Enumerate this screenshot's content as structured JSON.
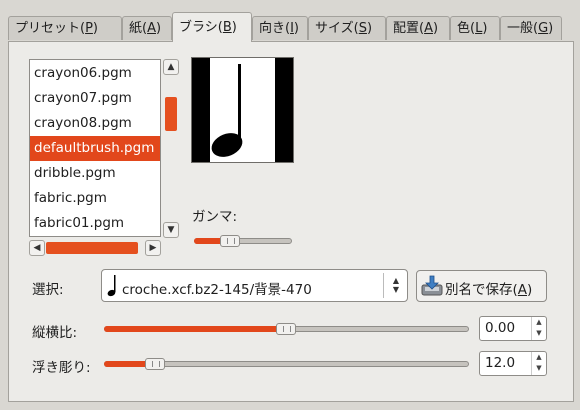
{
  "tabs": [
    {
      "label": "プリセット(",
      "key": "P",
      "tail": ")"
    },
    {
      "label": "紙(",
      "key": "A",
      "tail": ")"
    },
    {
      "label": "ブラシ(",
      "key": "B",
      "tail": ")"
    },
    {
      "label": "向き(",
      "key": "I",
      "tail": ")"
    },
    {
      "label": "サイズ(",
      "key": "S",
      "tail": ")"
    },
    {
      "label": "配置(",
      "key": "A",
      "tail": ")"
    },
    {
      "label": "色(",
      "key": "L",
      "tail": ")"
    },
    {
      "label": "一般(",
      "key": "G",
      "tail": ")"
    }
  ],
  "brush_list": {
    "items": [
      "crayon06.pgm",
      "crayon07.pgm",
      "crayon08.pgm",
      "defaultbrush.pgm",
      "dribble.pgm",
      "fabric.pgm",
      "fabric01.pgm"
    ],
    "selected_index": 3
  },
  "gamma": {
    "label": "ガンマ:",
    "level": 0.38
  },
  "select": {
    "label": "選択:",
    "value": "croche.xcf.bz2-145/背景-470"
  },
  "save_as": {
    "label": "別名で保存(",
    "key": "A",
    "tail": ")"
  },
  "aspect": {
    "label": "縦横比:",
    "value": "0.00",
    "level": 0.5
  },
  "relief": {
    "label": "浮き彫り:",
    "value": "12.0",
    "level": 0.12
  }
}
